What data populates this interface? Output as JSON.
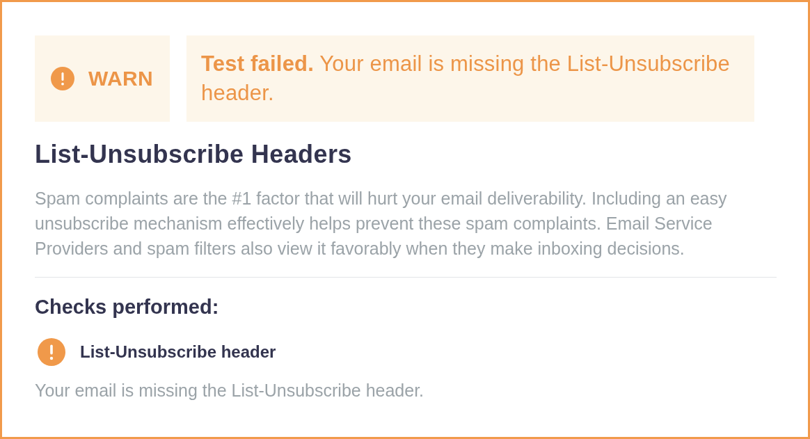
{
  "status_badge": {
    "kind": "warn",
    "label": "WARN"
  },
  "result_banner": {
    "kind": "warn",
    "message": "**Test failed.** Your email is missing the List-Unsubscribe header."
  },
  "section": {
    "title": "List-Unsubscribe Headers",
    "description": "Spam complaints are the #1 factor that will hurt your email deliverability. Including an easy unsubscribe mechanism effectively helps prevent these spam complaints. Email Service Providers and spam filters also view it favorably when they make inboxing decisions."
  },
  "checks": {
    "heading": "Checks performed:",
    "items": [
      {
        "kind": "warn",
        "name": "List-Unsubscribe header",
        "detail": "Your email is missing the List-Unsubscribe header."
      }
    ]
  }
}
